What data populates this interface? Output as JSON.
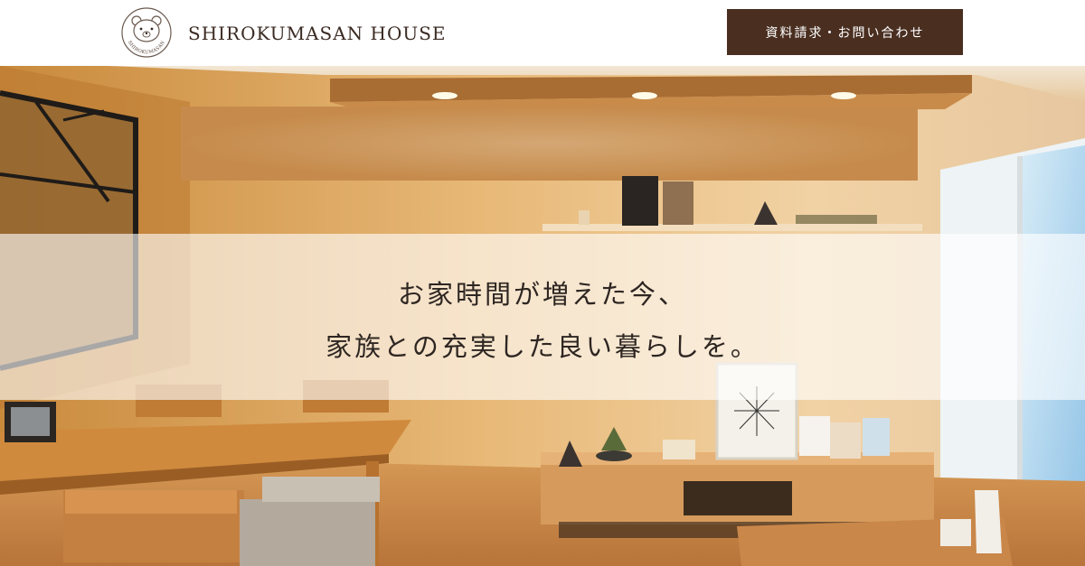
{
  "header": {
    "logo_text": "SHIROKUMASAN HOUSE",
    "logo_icon": "polar-bear-icon",
    "logo_ring_text": "SHIROKUMASAN HOUSE",
    "cta_label": "資料請求・お問い合わせ"
  },
  "hero": {
    "catch_line_1": "お家時間が増えた今、",
    "catch_line_2": "家族との充実した良い暮らしを。"
  },
  "colors": {
    "cta_background": "#4a2f21",
    "logo_text": "#3a2a22",
    "catch_text": "#2e2622"
  }
}
